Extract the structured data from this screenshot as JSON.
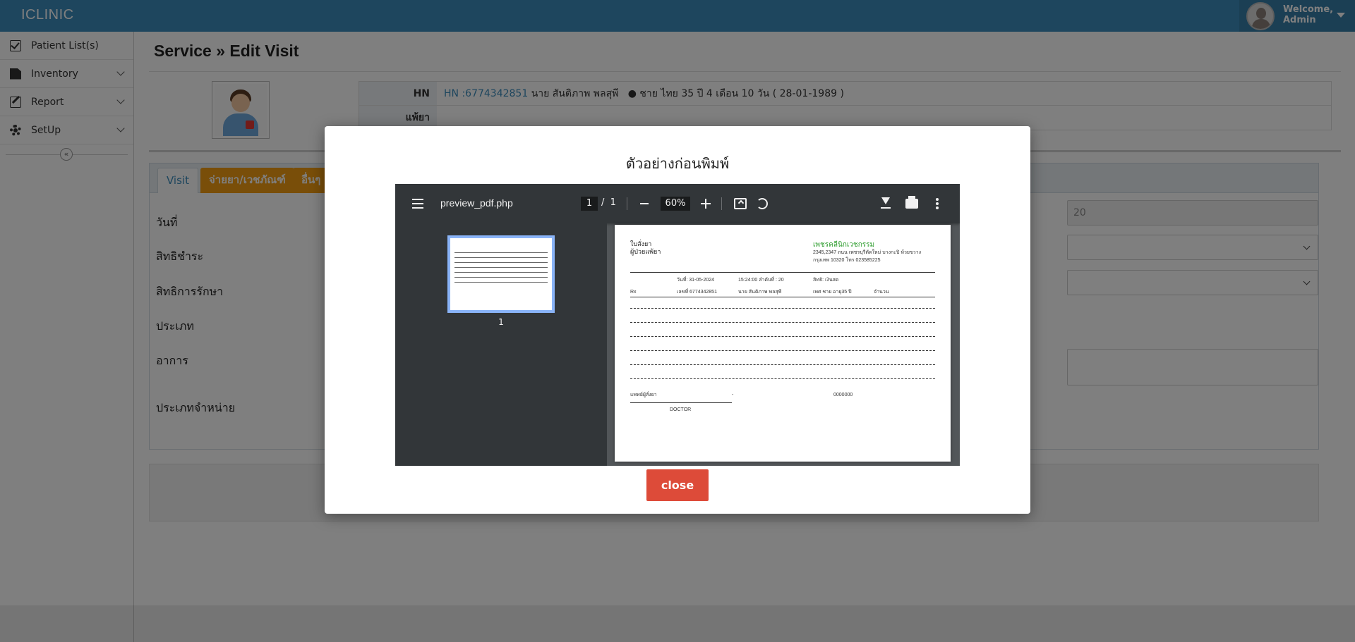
{
  "app": {
    "brand": "ICLINIC",
    "welcome_line1": "Welcome,",
    "welcome_line2": "Admin"
  },
  "sidebar": {
    "items": [
      {
        "label": "Patient List(s)",
        "icon": "check-square-icon",
        "has_submenu": false
      },
      {
        "label": "Inventory",
        "icon": "file-icon",
        "has_submenu": true
      },
      {
        "label": "Report",
        "icon": "edit-icon",
        "has_submenu": true
      },
      {
        "label": "SetUp",
        "icon": "gear-icon",
        "has_submenu": true
      }
    ],
    "collapse_glyph": "«"
  },
  "page": {
    "title": "Service » Edit Visit"
  },
  "patient": {
    "hn_label": "HN",
    "hn_value": "HN :6774342851",
    "name": "นาย  สันติภาพ  พลสุพี",
    "details": "ชาย  ไทย  35 ปี 4 เดือน 10 วัน (  28-01-1989  )",
    "allergy_label": "แพ้ยา",
    "allergy_value": ""
  },
  "tabs": [
    "Visit",
    "จ่ายยา/เวชภัณฑ์",
    "อื่นๆ"
  ],
  "form": {
    "labels": [
      "วันที่",
      "สิทธิชำระ",
      "สิทธิการรักษา",
      "ประเภท",
      "อาการ",
      "ประเภทจำหน่าย"
    ],
    "queue_value": "20"
  },
  "modal": {
    "title": "ตัวอย่างก่อนพิมพ์",
    "close_label": "close",
    "pdf": {
      "filename": "preview_pdf.php",
      "page_current": "1",
      "page_separator": "/",
      "page_total": "1",
      "zoom": "60%",
      "thumbnail_number": "1",
      "doc": {
        "left_line1": "ใบสั่งยา",
        "left_line2": "ผู้ป่วยแพ้ยา",
        "clinic_name": "เพชรคลีนิกเวชกรรม",
        "clinic_addr1": "2345,2347 ถนน เพชรบุรีตัดใหม่ บางกะปิ ห้วยขวาง",
        "clinic_addr2": "กรุงเทพ 10320 โทร 023585225",
        "date": "วันที่: 31-05-2024",
        "time_queue": "15:24:00 ลำดับที่ : 20",
        "right_rights": "สิทธิ: เงินสด",
        "rx": "Rx",
        "number": "เลขที่ 6774342851",
        "patient": "นาย  สันติภาพ  พลสุพี",
        "sex_age": "เพศ ชาย อายุ35 ปี",
        "qty": "จำนวน",
        "doctor_label": "แพทย์ผู้สั่งยา",
        "dot": "-",
        "license": "0000000",
        "doctor_name": "DOCTOR"
      }
    }
  }
}
